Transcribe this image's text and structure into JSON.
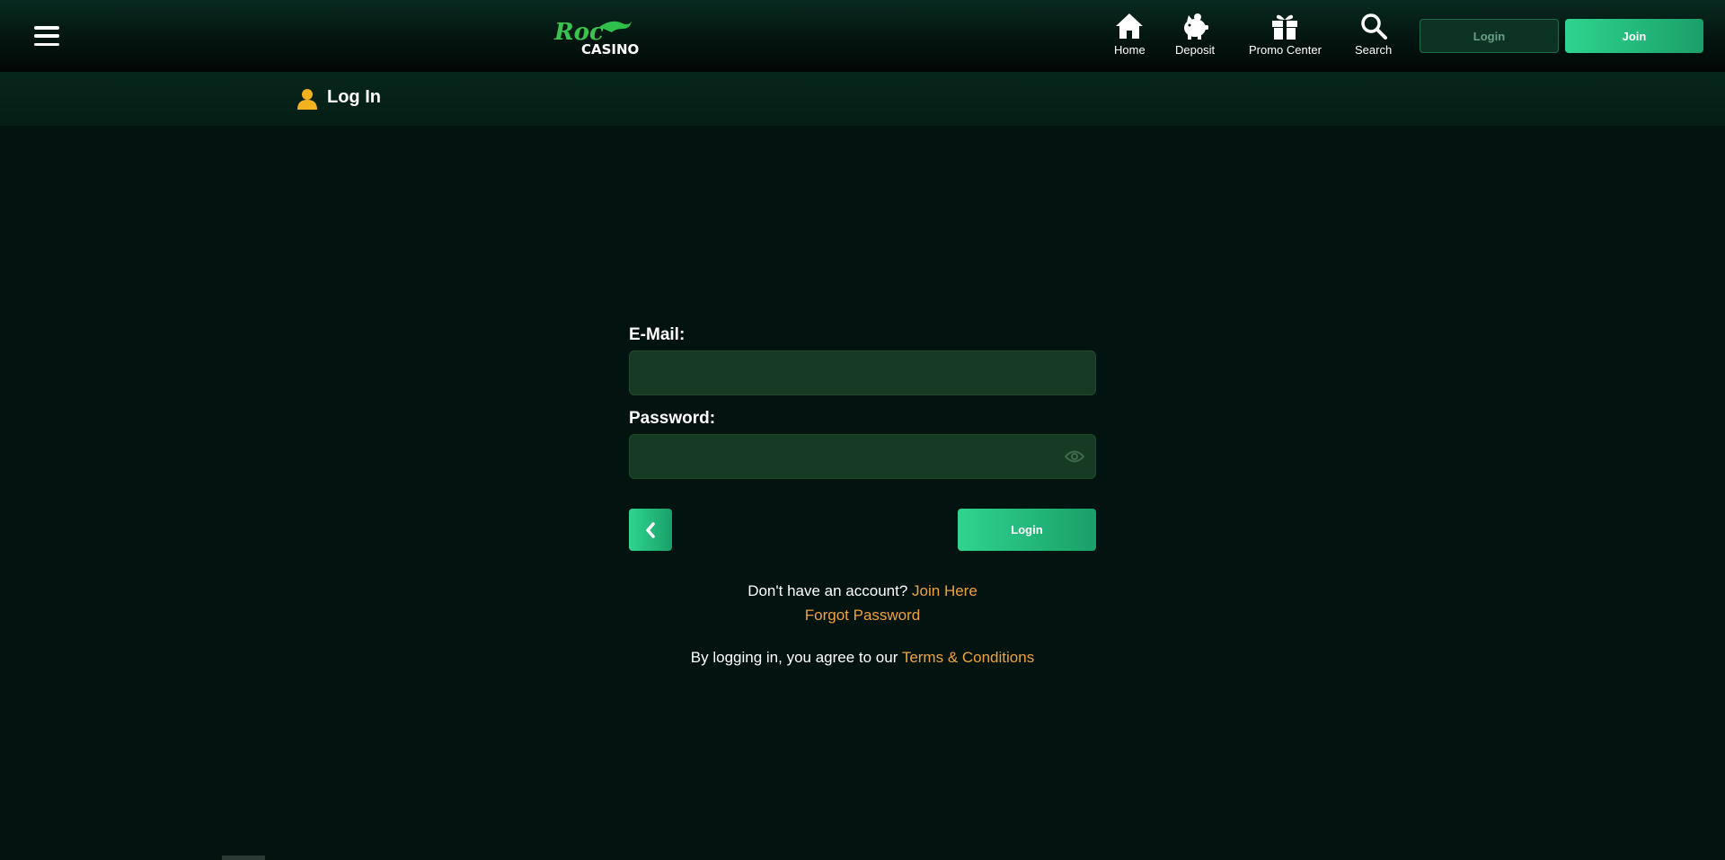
{
  "header": {
    "logo_text_top": "Roc",
    "logo_text_bottom": "CASINO",
    "nav": [
      {
        "label": "Home",
        "icon": "home-icon"
      },
      {
        "label": "Deposit",
        "icon": "piggy-bank-icon"
      },
      {
        "label": "Promo Center",
        "icon": "gift-icon"
      },
      {
        "label": "Search",
        "icon": "search-icon"
      }
    ],
    "login_label": "Login",
    "join_label": "Join"
  },
  "subbar": {
    "title": "Log In",
    "icon": "user-icon"
  },
  "form": {
    "email_label": "E-Mail:",
    "email_value": "",
    "password_label": "Password:",
    "password_value": "",
    "login_button": "Login",
    "no_account_text": "Don't have an account?",
    "join_here_link": "Join Here",
    "forgot_password_link": "Forgot Password",
    "agree_text": "By logging in, you agree to our",
    "terms_link": "Terms & Conditions"
  },
  "colors": {
    "background": "#031310",
    "accent": "#2ed48f",
    "link": "#f0a23a",
    "input_bg": "#173a24"
  }
}
